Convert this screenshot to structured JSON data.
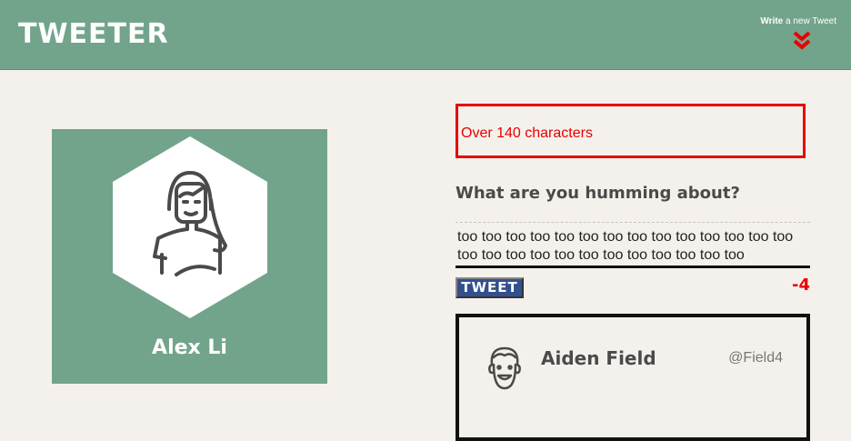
{
  "header": {
    "logo": "TWEETER",
    "write_link_bold": "Write",
    "write_link_rest": " a new Tweet",
    "chevron_icon": "double-chevron-down-icon",
    "accent_color": "#e80000",
    "header_color": "#72a48c"
  },
  "profile": {
    "name": "Alex Li",
    "avatar_icon": "woman-avatar-icon"
  },
  "compose": {
    "error_message": "Over 140 characters",
    "title": "What are you humming about?",
    "input_value": "too too too too too too too too too too too too too too too too too too too too too too too too too too",
    "button_label": "TWEET",
    "char_counter": "-4"
  },
  "tweets": [
    {
      "name": "Aiden Field",
      "handle": "@Field4",
      "avatar_icon": "man-avatar-icon"
    }
  ]
}
